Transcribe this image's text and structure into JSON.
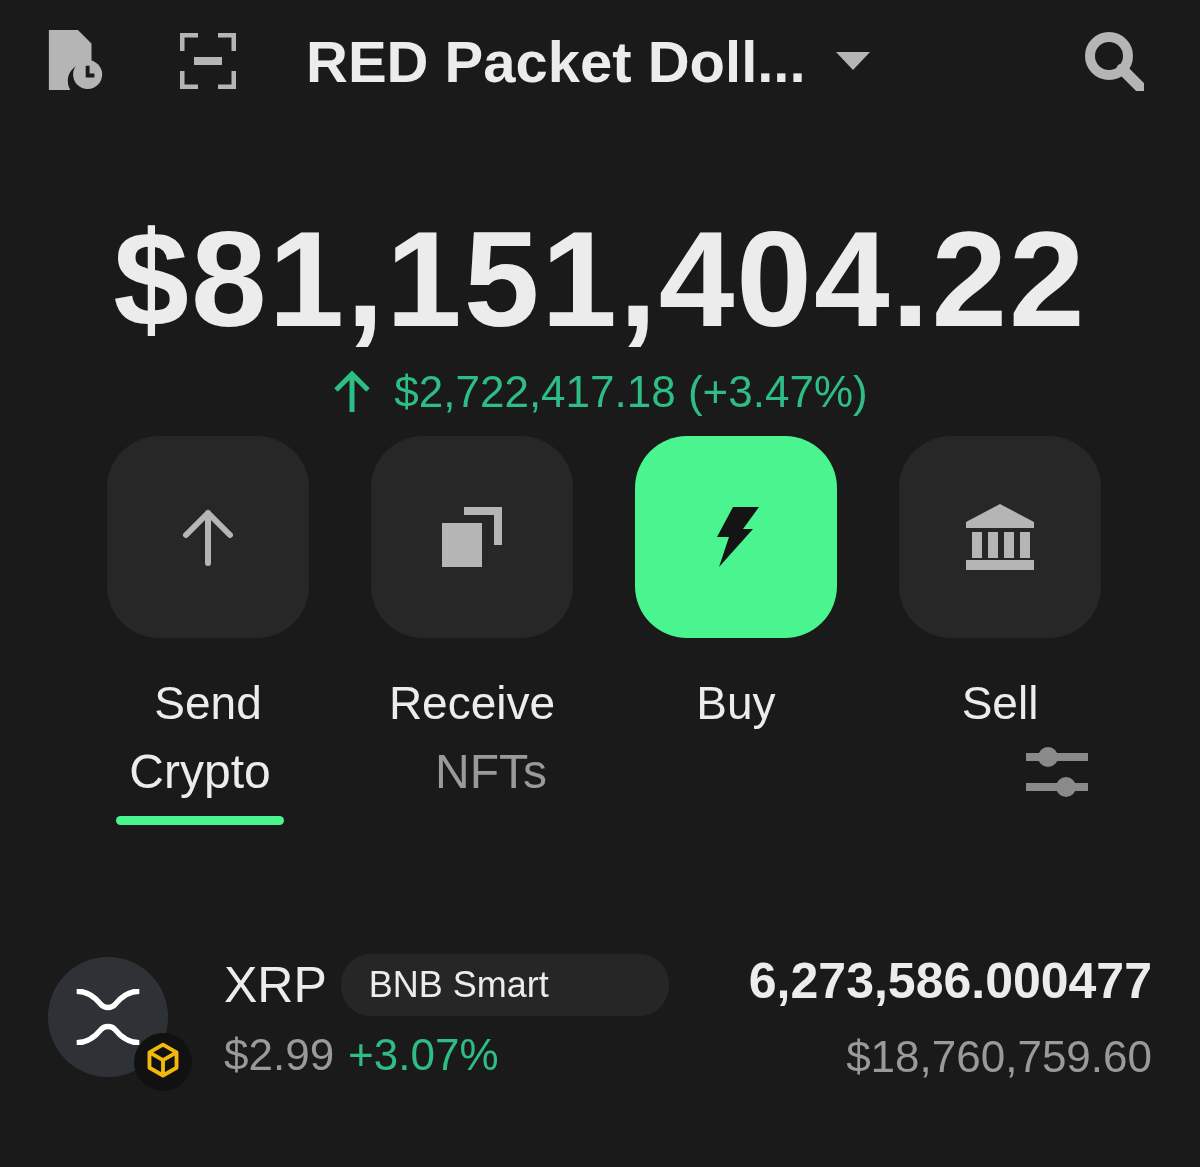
{
  "header": {
    "title": "RED Packet Doll..."
  },
  "balance": {
    "total": "$81,151,404.22",
    "change": "$2,722,417.18 (+3.47%)",
    "positive": true
  },
  "actions": [
    {
      "label": "Send",
      "kind": "send",
      "highlighted": false
    },
    {
      "label": "Receive",
      "kind": "receive",
      "highlighted": false
    },
    {
      "label": "Buy",
      "kind": "buy",
      "highlighted": true
    },
    {
      "label": "Sell",
      "kind": "sell",
      "highlighted": false
    }
  ],
  "tabs": [
    {
      "label": "Crypto",
      "selected": true
    },
    {
      "label": "NFTs",
      "selected": false
    }
  ],
  "assets": [
    {
      "symbol": "XRP",
      "network": "BNB Smart",
      "price": "$2.99",
      "change": "+3.07%",
      "positive": true,
      "amount": "6,273,586.000477",
      "value": "$18,760,759.60"
    }
  ]
}
